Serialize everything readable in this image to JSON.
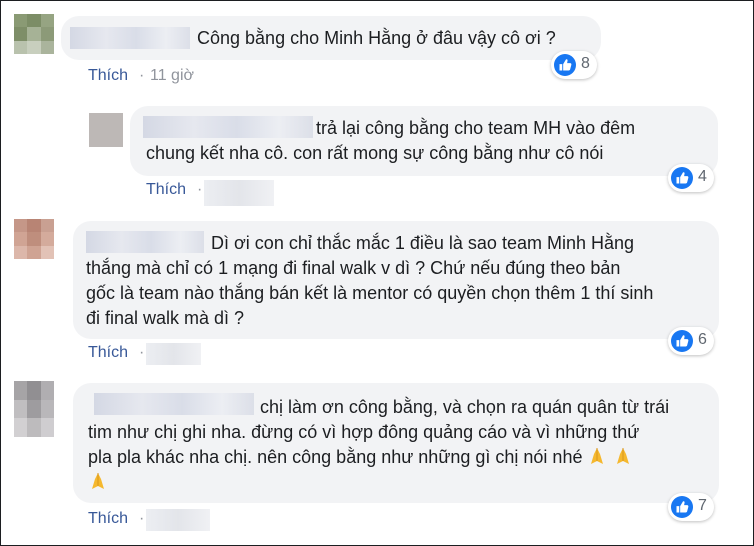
{
  "comments": [
    {
      "text_lines": [
        "Công bằng cho Minh Hằng ở đâu vậy cô ơi ?"
      ],
      "like_label": "Thích",
      "separator": "·",
      "time": "11 giờ",
      "reaction_count": "8"
    },
    {
      "text_lines": [
        "trả lại công bằng cho team MH vào đêm",
        "chung kết nha cô. con rất mong sự công bằng như cô nói"
      ],
      "like_label": "Thích",
      "separator": "·",
      "reaction_count": "4"
    },
    {
      "text_lines": [
        "Dì ơi con chỉ thắc mắc 1 điều là sao team Minh Hằng",
        "thắng mà chỉ có 1 mạng đi final walk v dì ? Chứ nếu đúng theo bản",
        "gốc là team nào thắng bán kết là mentor có quyền chọn thêm 1 thí sinh",
        "đi final walk mà dì ?"
      ],
      "like_label": "Thích",
      "separator": "·",
      "reaction_count": "6"
    },
    {
      "text_lines": [
        "chị làm ơn công bằng, và chọn ra quán quân từ trái",
        "tim như chị ghi nha. đừng có vì hợp đông quảng cáo và vì những thứ",
        "pla pla khác nha chị. nên công bằng như những gì chị nói nhé"
      ],
      "like_label": "Thích",
      "separator": "·",
      "reaction_count": "7"
    }
  ],
  "icons": {
    "reaction": "like-thumb-icon",
    "emoji": "folded-hands-emoji"
  },
  "colors": {
    "bubble": "#f2f3f5",
    "link": "#385898",
    "meta": "#90949c",
    "like_blue": "#1877f2",
    "emoji": "#f5b82e"
  }
}
